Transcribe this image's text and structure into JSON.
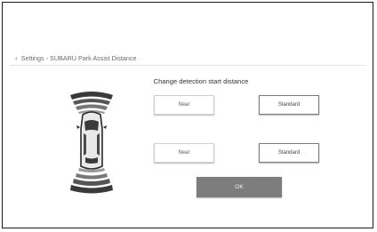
{
  "breadcrumb": {
    "back_icon": "chevron-left-icon",
    "text": "Settings - SUBARU Park Assist Distance"
  },
  "title": "Change detection start distance",
  "front": {
    "near_label": "Near",
    "standard_label": "Standard",
    "selected": "standard"
  },
  "rear": {
    "near_label": "Near",
    "standard_label": "Standard",
    "selected": "standard"
  },
  "ok_label": "OK"
}
